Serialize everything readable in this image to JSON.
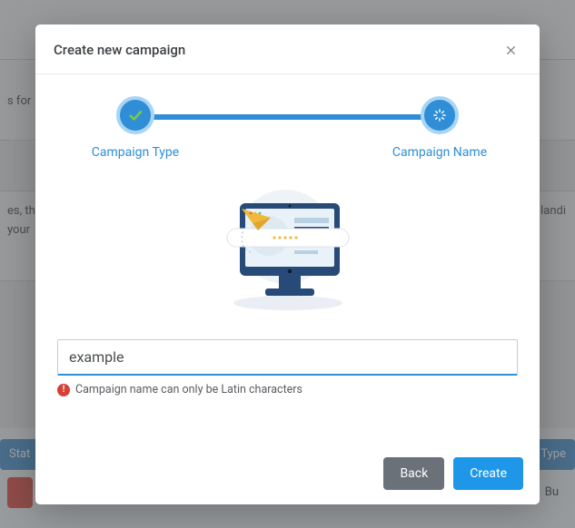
{
  "background": {
    "top_text": "s for",
    "mid_line1_left": "es, th",
    "mid_line1_right": "landi",
    "mid_line2": "your",
    "pill_stat": "Stat",
    "pill_type": "Type",
    "pill_bu": "Bu"
  },
  "modal": {
    "title": "Create new campaign",
    "steps": {
      "a": "Campaign Type",
      "b": "Campaign Name"
    },
    "input": {
      "value": "example",
      "placeholder": ""
    },
    "error": "Campaign name can only be Latin characters",
    "buttons": {
      "back": "Back",
      "create": "Create"
    }
  },
  "colors": {
    "accent": "#2f8ed6",
    "primary_btn": "#1f97e8",
    "secondary_btn": "#6a7178",
    "error": "#d64036"
  }
}
